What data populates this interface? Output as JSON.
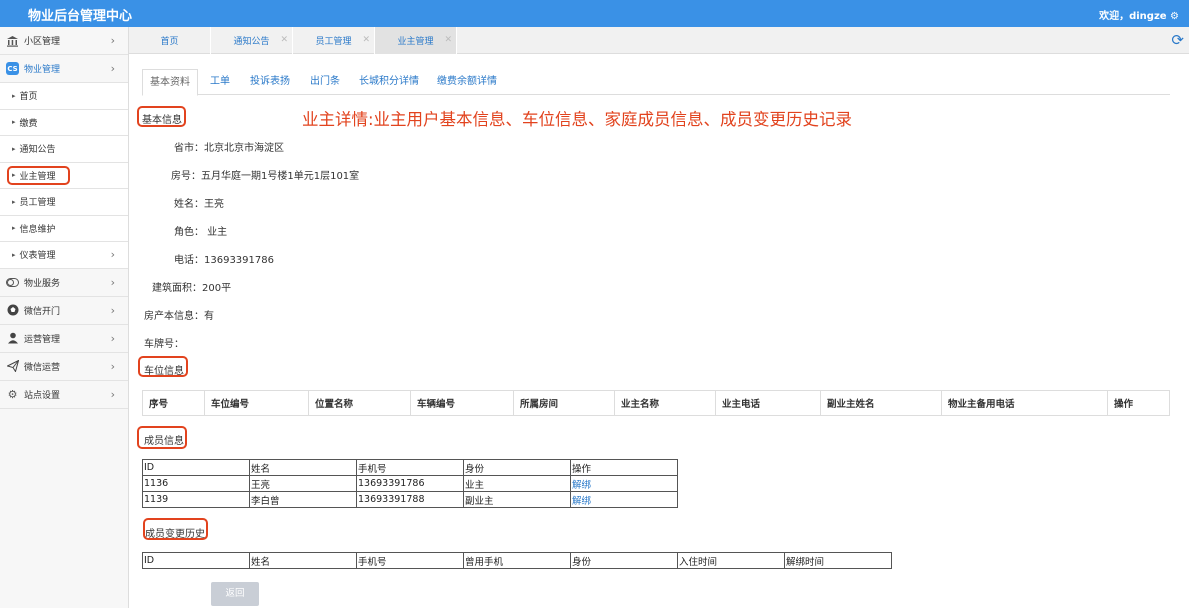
{
  "header": {
    "app_title": "物业后台管理中心",
    "welcome": "欢迎，dingze ⚙"
  },
  "sidebar": {
    "items": [
      {
        "label": "小区管理"
      },
      {
        "label": "物业管理"
      },
      {
        "label": "首页"
      },
      {
        "label": "缴费"
      },
      {
        "label": "通知公告"
      },
      {
        "label": "业主管理"
      },
      {
        "label": "员工管理"
      },
      {
        "label": "信息维护"
      },
      {
        "label": "仪表管理"
      },
      {
        "label": "物业服务"
      },
      {
        "label": "微信开门"
      },
      {
        "label": "运营管理"
      },
      {
        "label": "微信运营"
      },
      {
        "label": "站点设置"
      }
    ]
  },
  "page_tabs": [
    {
      "label": "首页"
    },
    {
      "label": "通知公告"
    },
    {
      "label": "员工管理"
    },
    {
      "label": "业主管理"
    }
  ],
  "sub_tabs": [
    {
      "label": "基本资料"
    },
    {
      "label": "工单"
    },
    {
      "label": "投诉表扬"
    },
    {
      "label": "出门条"
    },
    {
      "label": "长城积分详情"
    },
    {
      "label": "缴费余额详情"
    }
  ],
  "annotation": "业主详情:业主用户基本信息、车位信息、家庭成员信息、成员变更历史记录",
  "basic_info": {
    "title": "基本信息",
    "fields": [
      {
        "text": "省市：北京北京市海淀区"
      },
      {
        "text": "房号：五月华庭一期1号楼1单元1层101室"
      },
      {
        "text": "姓名：王亮"
      },
      {
        "text": "角色： 业主"
      },
      {
        "text": "电话：13693391786"
      },
      {
        "text": "建筑面积：200平"
      },
      {
        "text": "房产本信息：有"
      },
      {
        "text": "车牌号："
      }
    ]
  },
  "parking": {
    "title": "车位信息",
    "headers": [
      "序号",
      "车位编号",
      "位置名称",
      "车辆编号",
      "所属房间",
      "业主名称",
      "业主电话",
      "副业主姓名",
      "物业主备用电话",
      "操作"
    ]
  },
  "members": {
    "title": "成员信息",
    "headers": [
      "ID",
      "姓名",
      "手机号",
      "身份",
      "操作"
    ],
    "rows": [
      [
        "1136",
        "王亮",
        "13693391786",
        "业主",
        "解绑"
      ],
      [
        "1139",
        "李白曾",
        "13693391788",
        "副业主",
        "解绑"
      ]
    ]
  },
  "history": {
    "title": "成员变更历史",
    "headers": [
      "ID",
      "姓名",
      "手机号",
      "曾用手机",
      "身份",
      "入住时间",
      "解绑时间"
    ]
  },
  "back_label": "返回"
}
